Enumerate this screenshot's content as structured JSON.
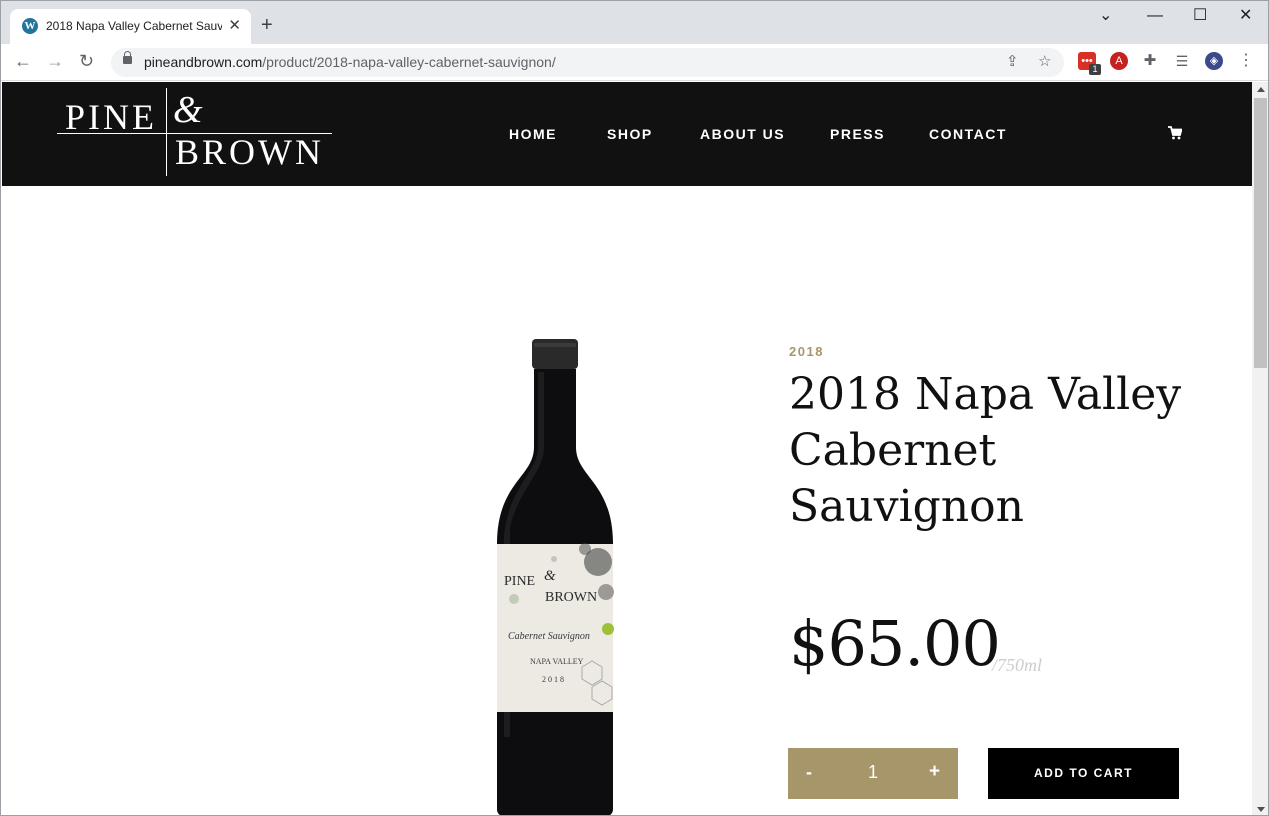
{
  "browser": {
    "tab_title": "2018 Napa Valley Cabernet Sauvignon",
    "favicon": "W",
    "url_host": "pineandbrown.com",
    "url_path": "/product/2018-napa-valley-cabernet-sauvignon/",
    "ext_badge": "1",
    "ext_avatar_letter": "A"
  },
  "site": {
    "logo": {
      "pine": "PINE",
      "amp": "&",
      "brown": "BROWN"
    },
    "nav": [
      "HOME",
      "SHOP",
      "ABOUT US",
      "PRESS",
      "CONTACT"
    ]
  },
  "product": {
    "vintage": "2018",
    "title": "2018 Napa Valley Cabernet Sauvignon",
    "price": "$65.00",
    "unit": "/750ml",
    "quantity": "1",
    "minus": "-",
    "plus": "+",
    "add_to_cart": "ADD TO CART",
    "label": {
      "brand_pine": "PINE",
      "brand_amp": "&",
      "brand_brown": "BROWN",
      "varietal": "Cabernet Sauvignon",
      "region": "NAPA VALLEY",
      "year": "2018"
    }
  },
  "colors": {
    "accent": "#a8966b",
    "header": "#111111"
  }
}
